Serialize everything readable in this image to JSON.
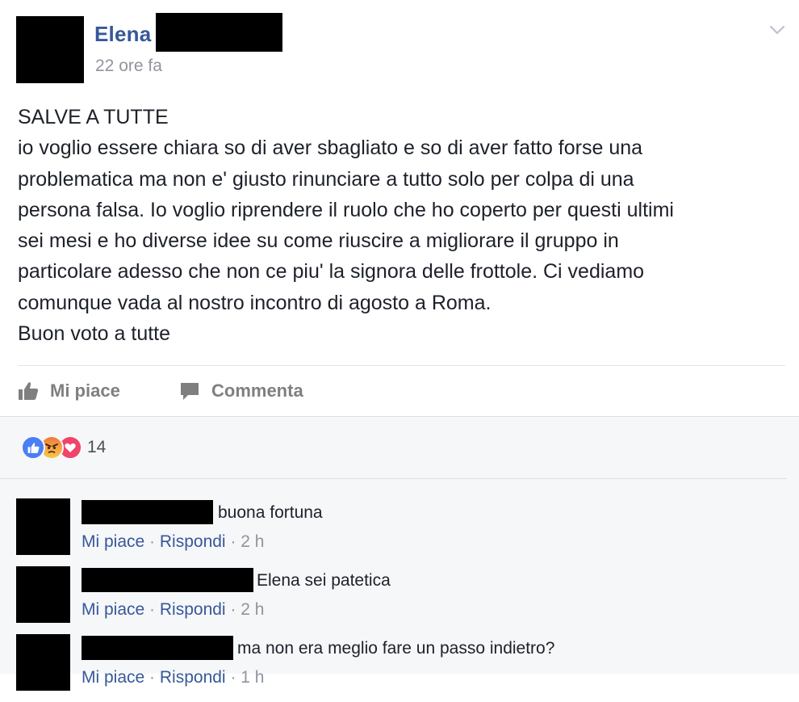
{
  "post": {
    "author_first_name": "Elena",
    "timestamp": "22 ore fa",
    "body_lines": [
      "SALVE A TUTTE",
      "io voglio essere chiara so di aver sbagliato e so di aver fatto forse una",
      "problematica ma non e' giusto rinunciare a tutto solo per colpa di una",
      "persona falsa. Io voglio riprendere il ruolo che ho coperto per questi ultimi",
      "sei mesi e ho diverse idee su come riuscire a migliorare il gruppo in",
      "particolare adesso che non ce piu' la signora delle frottole. Ci vediamo",
      "comunque vada al nostro incontro di agosto a Roma.",
      "Buon voto a tutte"
    ]
  },
  "actions": {
    "like_label": "Mi piace",
    "comment_label": "Commenta"
  },
  "reactions": {
    "icons": [
      "like-icon",
      "angry-icon",
      "love-icon"
    ],
    "count": "14",
    "colors": {
      "like": "#4a7ef4",
      "angry": "#f5a623",
      "love": "#f0446a"
    }
  },
  "comments": [
    {
      "text": "buona fortuna",
      "like_label": "Mi piace",
      "reply_label": "Rispondi",
      "time": "2 h"
    },
    {
      "text": "Elena sei patetica",
      "like_label": "Mi piace",
      "reply_label": "Rispondi",
      "time": "2 h"
    },
    {
      "text": "ma non era meglio fare un passo indietro?",
      "like_label": "Mi piace",
      "reply_label": "Rispondi",
      "time": "1 h"
    }
  ],
  "colors": {
    "link_blue": "#365899",
    "muted_gray": "#90949c",
    "comments_bg": "#f6f7f9"
  }
}
